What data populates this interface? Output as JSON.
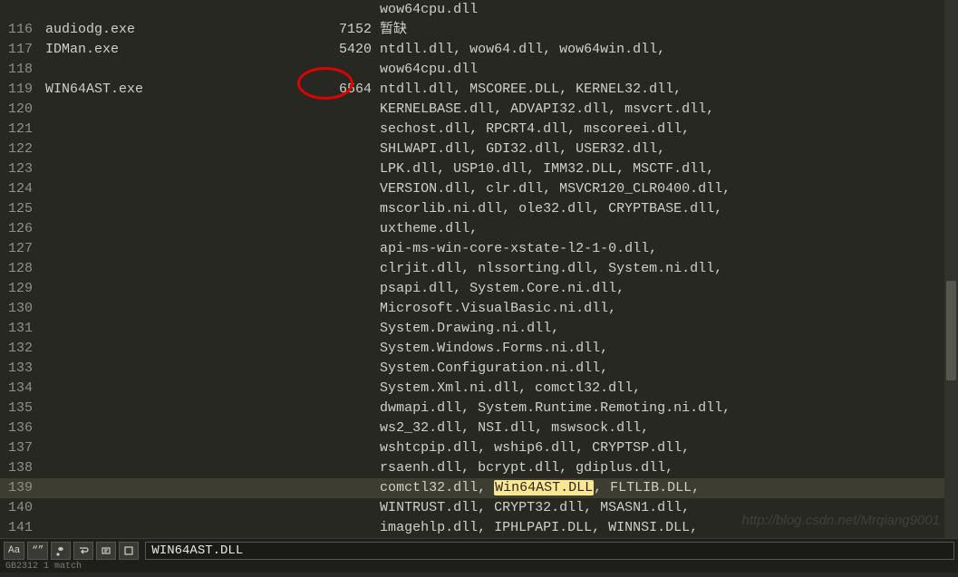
{
  "lines": [
    {
      "num": "",
      "col1": "",
      "col2": "",
      "col3": "wow64cpu.dll"
    },
    {
      "num": "116",
      "col1": "audiodg.exe",
      "col2": "7152",
      "col3": "暂缺"
    },
    {
      "num": "117",
      "col1": "IDMan.exe",
      "col2": "5420",
      "col3": "ntdll.dll, wow64.dll, wow64win.dll,"
    },
    {
      "num": "118",
      "col1": "",
      "col2": "",
      "col3": "wow64cpu.dll"
    },
    {
      "num": "119",
      "col1": "WIN64AST.exe",
      "col2": "6564",
      "col3": "ntdll.dll, MSCOREE.DLL, KERNEL32.dll,"
    },
    {
      "num": "120",
      "col1": "",
      "col2": "",
      "col3": "KERNELBASE.dll, ADVAPI32.dll, msvcrt.dll,"
    },
    {
      "num": "121",
      "col1": "",
      "col2": "",
      "col3": "sechost.dll, RPCRT4.dll, mscoreei.dll,"
    },
    {
      "num": "122",
      "col1": "",
      "col2": "",
      "col3": "SHLWAPI.dll, GDI32.dll, USER32.dll,"
    },
    {
      "num": "123",
      "col1": "",
      "col2": "",
      "col3": "LPK.dll, USP10.dll, IMM32.DLL, MSCTF.dll,"
    },
    {
      "num": "124",
      "col1": "",
      "col2": "",
      "col3": "VERSION.dll, clr.dll, MSVCR120_CLR0400.dll,"
    },
    {
      "num": "125",
      "col1": "",
      "col2": "",
      "col3": "mscorlib.ni.dll, ole32.dll, CRYPTBASE.dll,"
    },
    {
      "num": "126",
      "col1": "",
      "col2": "",
      "col3": "uxtheme.dll,"
    },
    {
      "num": "127",
      "col1": "",
      "col2": "",
      "col3": "api-ms-win-core-xstate-l2-1-0.dll,"
    },
    {
      "num": "128",
      "col1": "",
      "col2": "",
      "col3": "clrjit.dll, nlssorting.dll, System.ni.dll,"
    },
    {
      "num": "129",
      "col1": "",
      "col2": "",
      "col3": "psapi.dll, System.Core.ni.dll,"
    },
    {
      "num": "130",
      "col1": "",
      "col2": "",
      "col3": "Microsoft.VisualBasic.ni.dll,"
    },
    {
      "num": "131",
      "col1": "",
      "col2": "",
      "col3": "System.Drawing.ni.dll,"
    },
    {
      "num": "132",
      "col1": "",
      "col2": "",
      "col3": "System.Windows.Forms.ni.dll,"
    },
    {
      "num": "133",
      "col1": "",
      "col2": "",
      "col3": "System.Configuration.ni.dll,"
    },
    {
      "num": "134",
      "col1": "",
      "col2": "",
      "col3": "System.Xml.ni.dll, comctl32.dll,"
    },
    {
      "num": "135",
      "col1": "",
      "col2": "",
      "col3": "dwmapi.dll, System.Runtime.Remoting.ni.dll,"
    },
    {
      "num": "136",
      "col1": "",
      "col2": "",
      "col3": "ws2_32.dll, NSI.dll, mswsock.dll,"
    },
    {
      "num": "137",
      "col1": "",
      "col2": "",
      "col3": "wshtcpip.dll, wship6.dll, CRYPTSP.dll,"
    },
    {
      "num": "138",
      "col1": "",
      "col2": "",
      "col3": "rsaenh.dll, bcrypt.dll, gdiplus.dll,"
    },
    {
      "num": "139",
      "col1": "",
      "col2": "",
      "col3_pre": "comctl32.dll, ",
      "col3_hl": "Win64AST.DLL",
      "col3_post": ", FLTLIB.DLL,",
      "highlighted": true
    },
    {
      "num": "140",
      "col1": "",
      "col2": "",
      "col3": "WINTRUST.dll, CRYPT32.dll, MSASN1.dll,"
    },
    {
      "num": "141",
      "col1": "",
      "col2": "",
      "col3": "imagehlp.dll, IPHLPAPI.DLL, WINNSI.DLL,"
    }
  ],
  "search": {
    "btn_case": "Aa",
    "btn_word": "“”",
    "value": "WIN64AST.DLL"
  },
  "status": "GB2312  1 match",
  "watermark": "http://blog.csdn.net/Mrqiang9001",
  "col1_width": 35,
  "col2_width": 5
}
